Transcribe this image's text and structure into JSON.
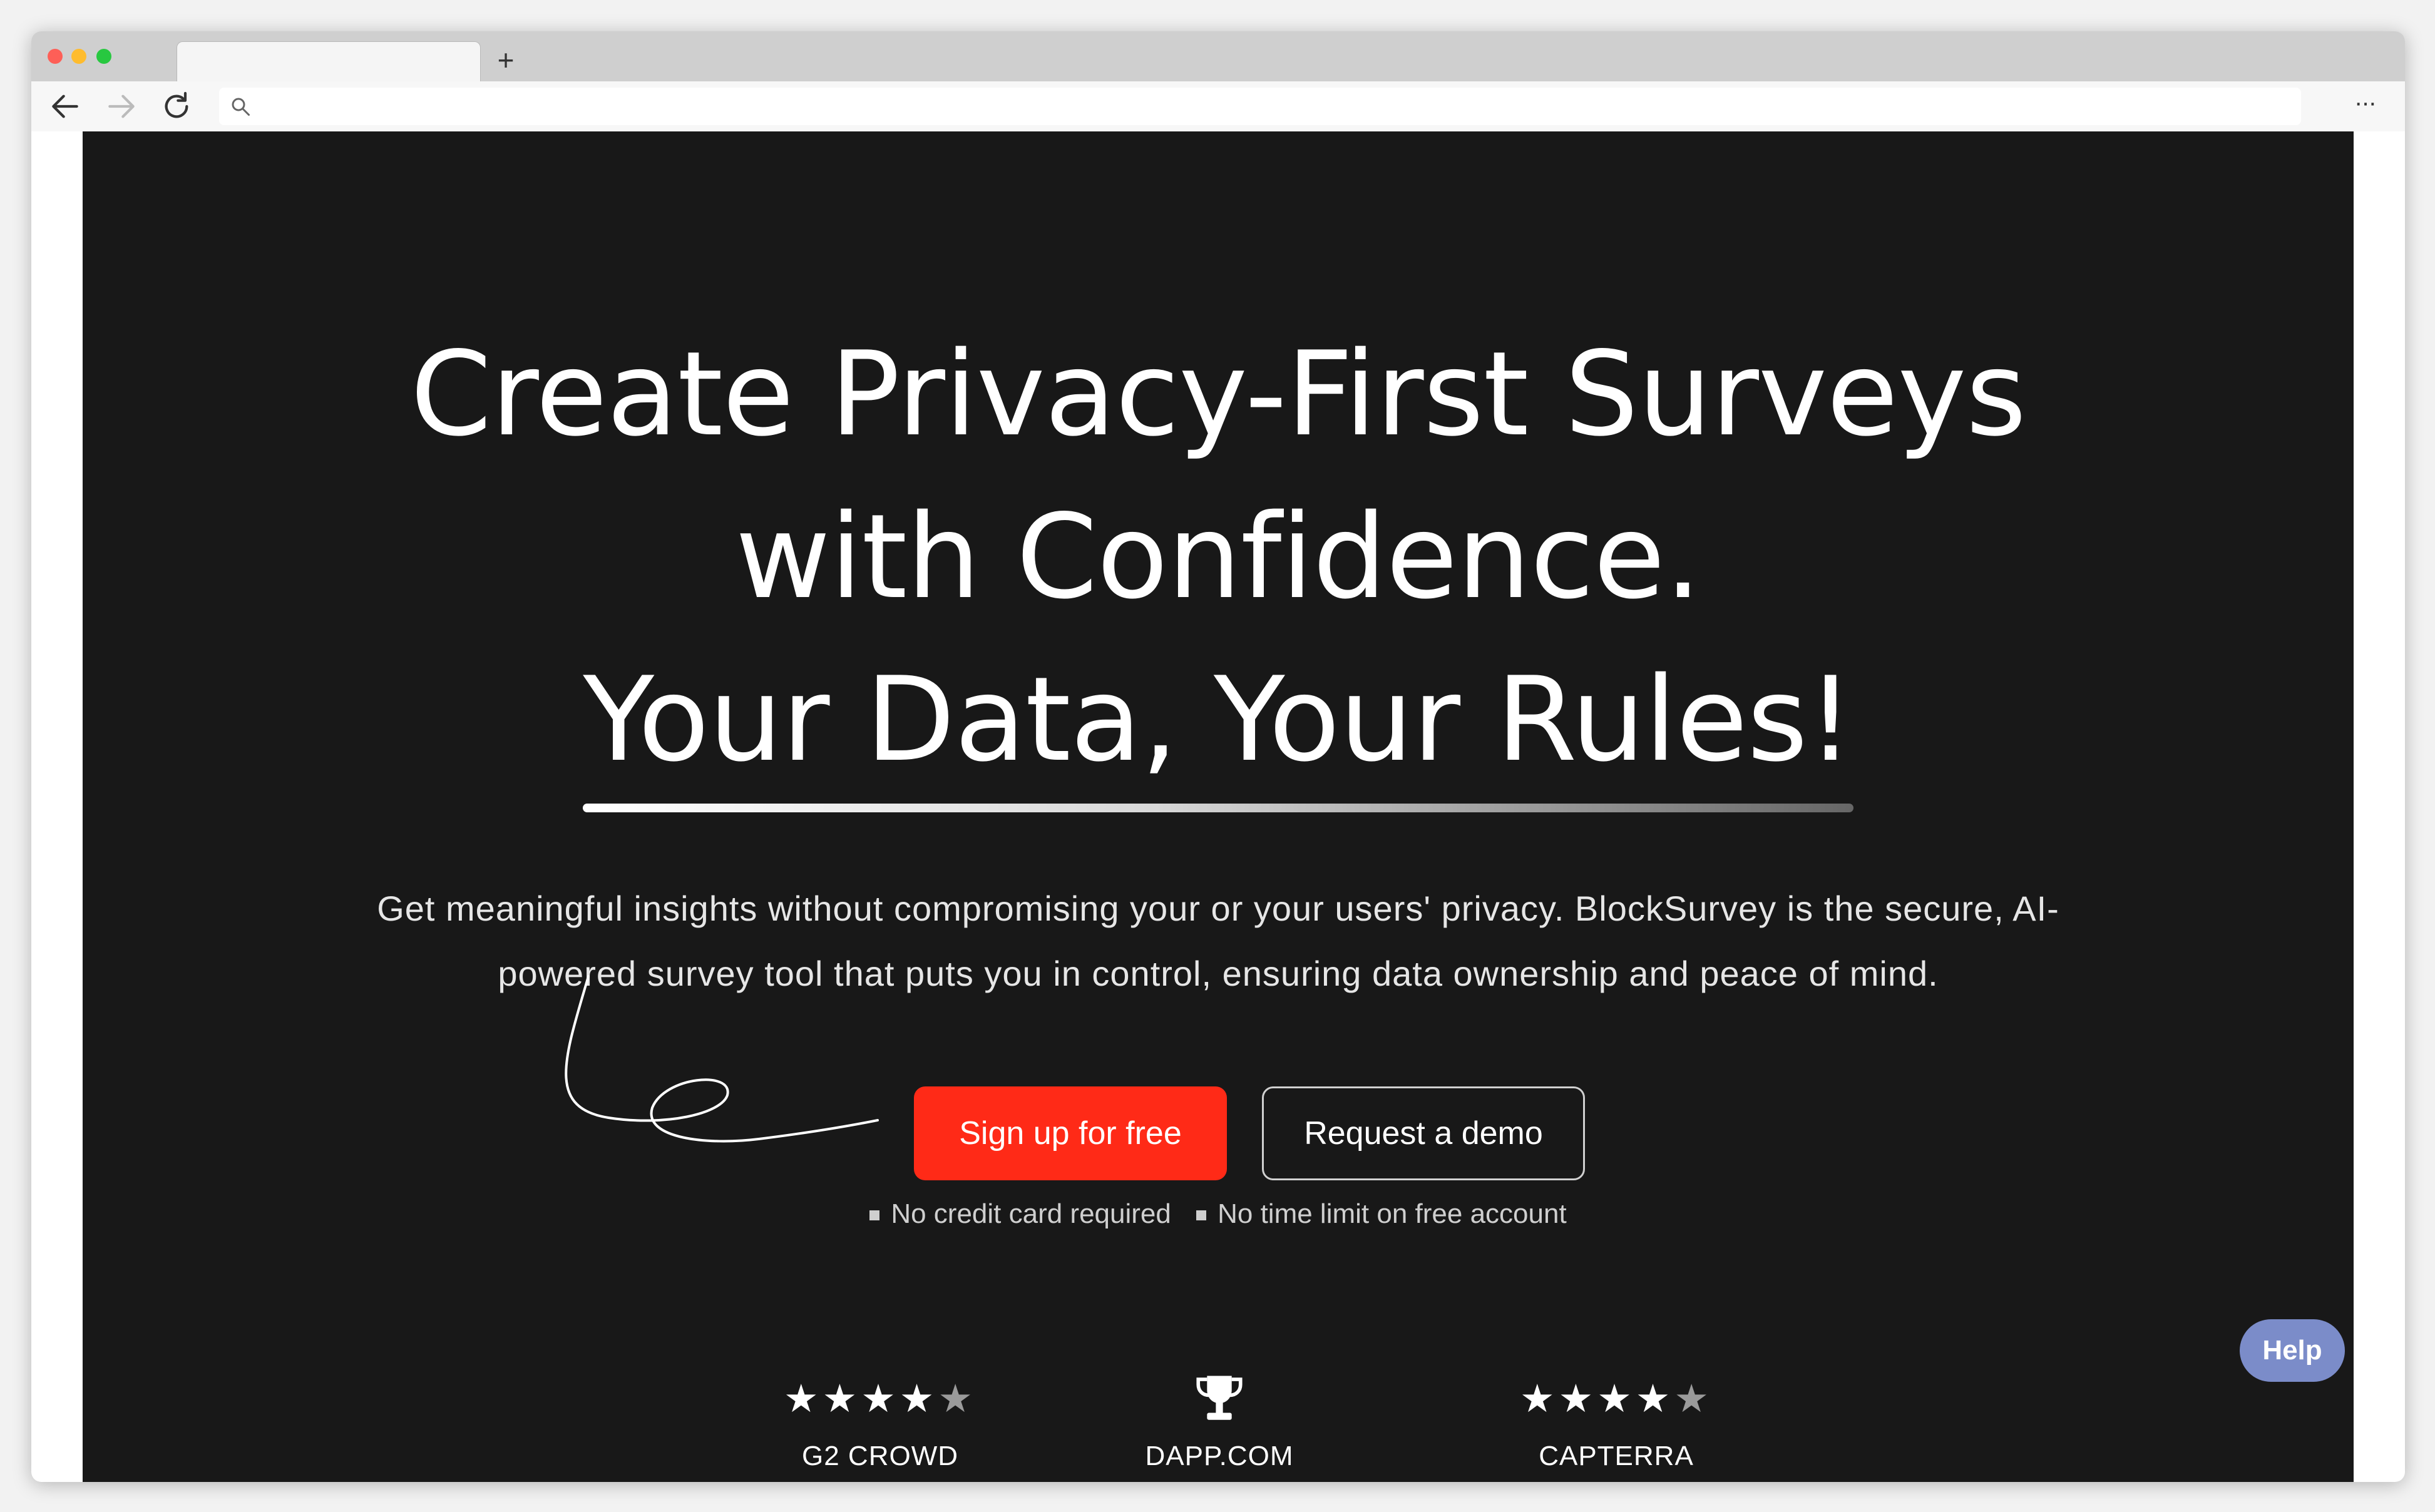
{
  "browser": {
    "new_tab_symbol": "+",
    "menu_symbol": "···"
  },
  "hero": {
    "headline_line1": "Create Privacy-First Surveys",
    "headline_line2": "with Confidence.",
    "headline_line3": "Your Data, Your Rules!",
    "subtext": "Get meaningful insights without compromising your or your users' privacy. BlockSurvey is the secure, AI-powered survey tool that puts you in control, ensuring data ownership and peace of mind.",
    "primary_cta": "Sign up for free",
    "secondary_cta": "Request a demo",
    "notes": [
      "No credit card required",
      "No time limit on free account"
    ]
  },
  "awards": [
    {
      "label": "G2 CROWD",
      "icon": "stars-icon",
      "rating": 4.5
    },
    {
      "label": "DAPP.COM",
      "icon": "trophy-icon"
    },
    {
      "label": "CAPTERRA",
      "icon": "stars-icon",
      "rating": 4.5
    }
  ],
  "help": {
    "label": "Help",
    "color": "#7b8cc9"
  },
  "colors": {
    "page_bg": "#181818",
    "primary": "#ff2a17"
  }
}
